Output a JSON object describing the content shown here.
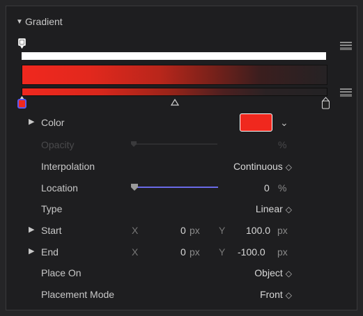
{
  "section": {
    "title": "Gradient",
    "toggle_glyph": "▼"
  },
  "colors": {
    "accent": "#f0281e",
    "panel_bg": "#1e1e20",
    "slider": "#6a6ae8"
  },
  "rows": {
    "color": {
      "label": "Color",
      "expand_glyph": "▶",
      "chevron": "⌄"
    },
    "opacity": {
      "label": "Opacity",
      "unit": "%"
    },
    "interpolation": {
      "label": "Interpolation",
      "value": "Continuous",
      "stepper": "◇"
    },
    "location": {
      "label": "Location",
      "value": "0",
      "unit": "%"
    },
    "type": {
      "label": "Type",
      "value": "Linear",
      "stepper": "◇"
    },
    "start": {
      "label": "Start",
      "expand_glyph": "▶",
      "x_label": "X",
      "x_value": "0",
      "x_unit": "px",
      "y_label": "Y",
      "y_value": "100.0",
      "y_unit": "px"
    },
    "end": {
      "label": "End",
      "expand_glyph": "▶",
      "x_label": "X",
      "x_value": "0",
      "x_unit": "px",
      "y_label": "Y",
      "y_value": "-100.0",
      "y_unit": "px"
    },
    "place_on": {
      "label": "Place On",
      "value": "Object",
      "stepper": "◇"
    },
    "placement_mode": {
      "label": "Placement Mode",
      "value": "Front",
      "stepper": "◇"
    }
  },
  "icons": {
    "opacity_stop": "opacity-stop-icon",
    "color_stop": "color-stop-icon",
    "midpoint": "midpoint-marker-icon",
    "menu": "gradient-presets-menu-icon"
  }
}
